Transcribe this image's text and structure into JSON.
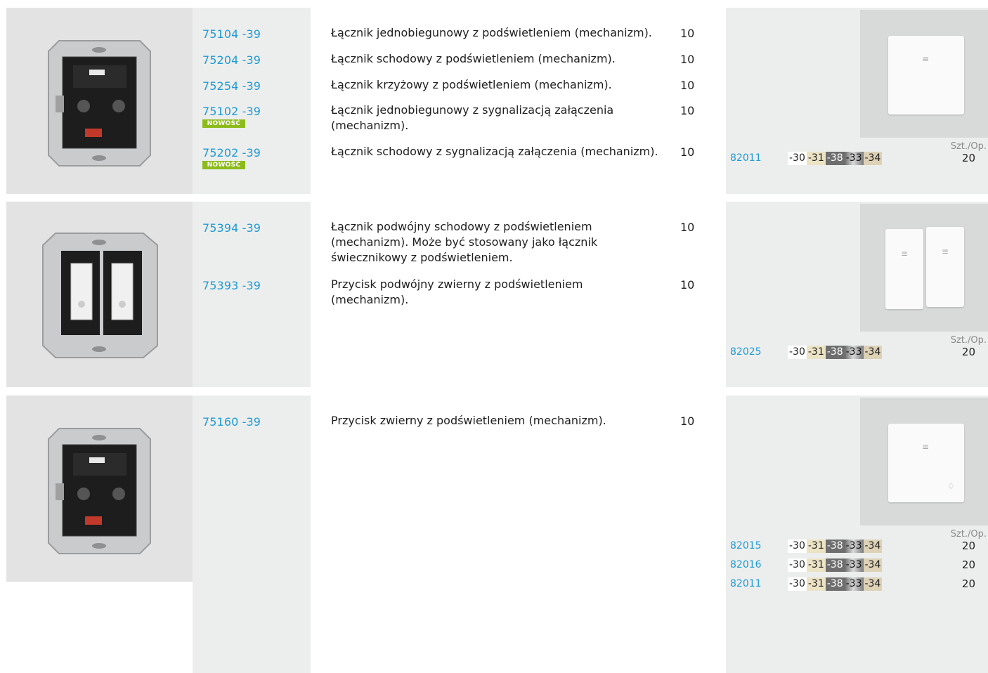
{
  "rows": [
    {
      "codes": [
        {
          "code": "75104 -39",
          "badge": ""
        },
        {
          "code": "75204 -39",
          "badge": ""
        },
        {
          "code": "75254 -39",
          "badge": ""
        },
        {
          "code": "75102 -39",
          "badge": "NOWOŚĆ"
        },
        {
          "code": "75202 -39",
          "badge": "NOWOŚĆ"
        }
      ],
      "descriptions": [
        {
          "text": "Łącznik jednobiegunowy z podświetleniem (mechanizm).",
          "qty": "10"
        },
        {
          "text": "Łącznik schodowy z podświetleniem (mechanizm).",
          "qty": "10"
        },
        {
          "text": "Łącznik krzyżowy z podświetleniem (mechanizm).",
          "qty": "10"
        },
        {
          "text": "Łącznik jednobiegunowy z sygnalizacją załączenia (mechanizm).",
          "qty": "10"
        },
        {
          "text": "Łącznik schodowy z sygnalizacją załączenia (mechanizm).",
          "qty": "10"
        }
      ],
      "accessories": [
        {
          "code": "82011",
          "qty": "20"
        }
      ]
    },
    {
      "codes": [
        {
          "code": "75394 -39",
          "badge": ""
        },
        {
          "code": "75393 -39",
          "badge": ""
        }
      ],
      "descriptions": [
        {
          "text": "Łącznik podwójny schodowy z podświetleniem (mechanizm). Może być stosowany jako łącznik świecznikowy z podświetleniem.",
          "qty": "10"
        },
        {
          "text": "Przycisk podwójny zwierny z podświetleniem (mechanizm).",
          "qty": "10"
        }
      ],
      "accessories": [
        {
          "code": "82025",
          "qty": "20"
        }
      ]
    },
    {
      "codes": [
        {
          "code": "75160 -39",
          "badge": ""
        }
      ],
      "descriptions": [
        {
          "text": "Przycisk zwierny z podświetleniem (mechanizm).",
          "qty": "10"
        }
      ],
      "accessories": [
        {
          "code": "82015",
          "qty": "20"
        },
        {
          "code": "82016",
          "qty": "20"
        },
        {
          "code": "82011",
          "qty": "20"
        }
      ]
    }
  ],
  "qty_header": "Szt./Op.",
  "finishes": [
    "-30",
    "-31",
    "-38",
    "-33",
    "-34"
  ],
  "colors": {
    "code_blue": "#1f9ad6",
    "badge_green": "#8dbb1c",
    "panel_grey": "#eceeed"
  }
}
